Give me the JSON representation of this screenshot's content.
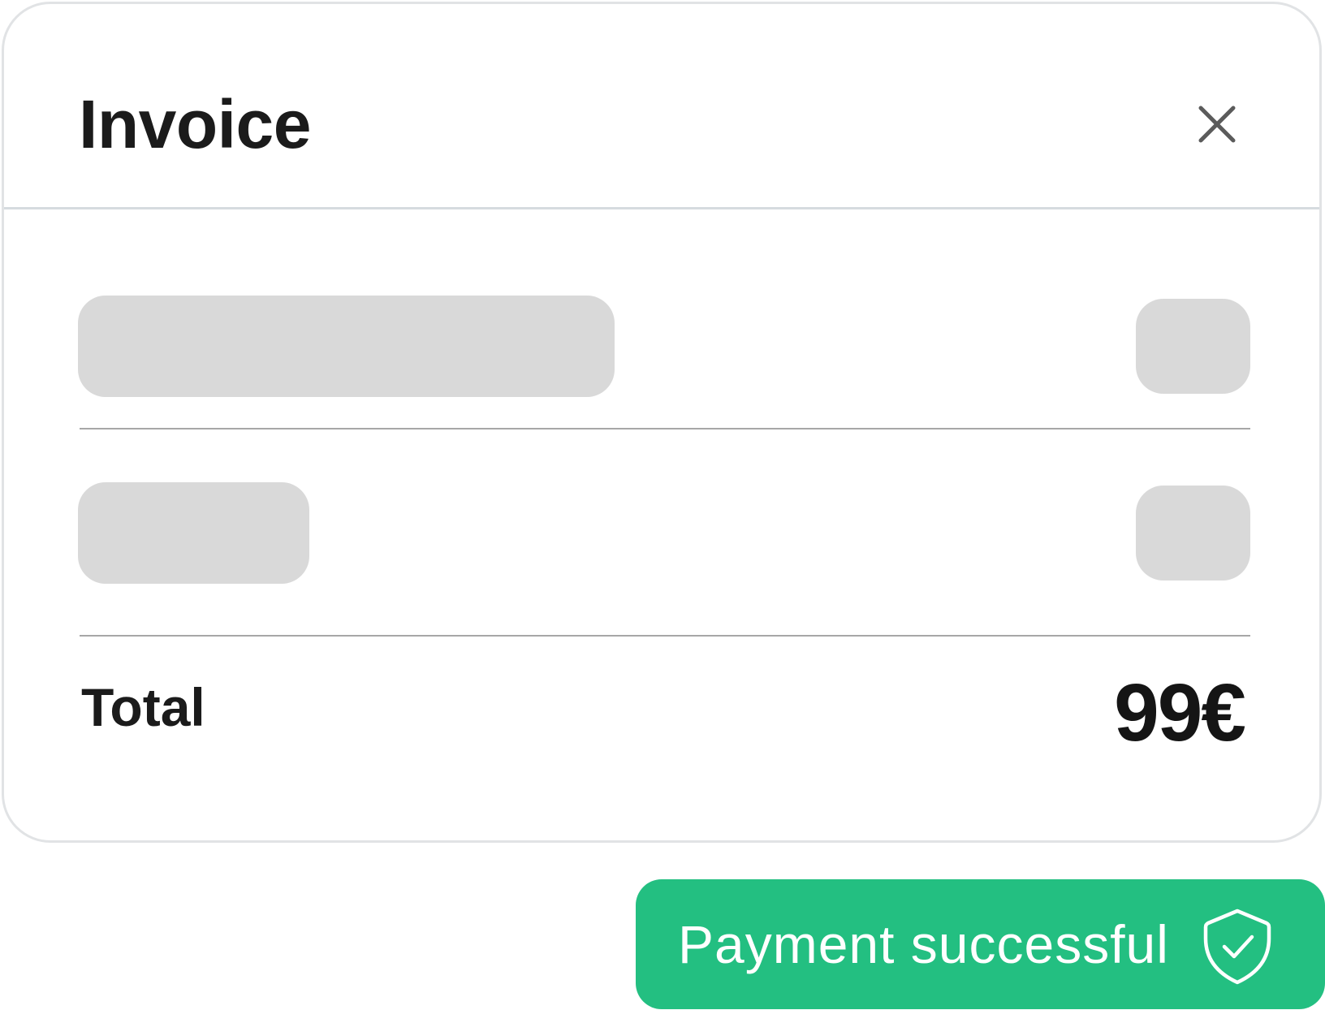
{
  "invoice": {
    "title": "Invoice",
    "close_icon": "close-icon",
    "line_items_loading": 2,
    "total_label": "Total",
    "total_value": "99€"
  },
  "toast": {
    "message": "Payment successful",
    "icon": "shield-check-icon",
    "background_color": "#23bf81",
    "text_color": "#ffffff"
  },
  "colors": {
    "skeleton": "#d9d9d9",
    "divider": "#a7a7a7",
    "card_border": "#e1e3e5",
    "text": "#1b1b1b"
  }
}
